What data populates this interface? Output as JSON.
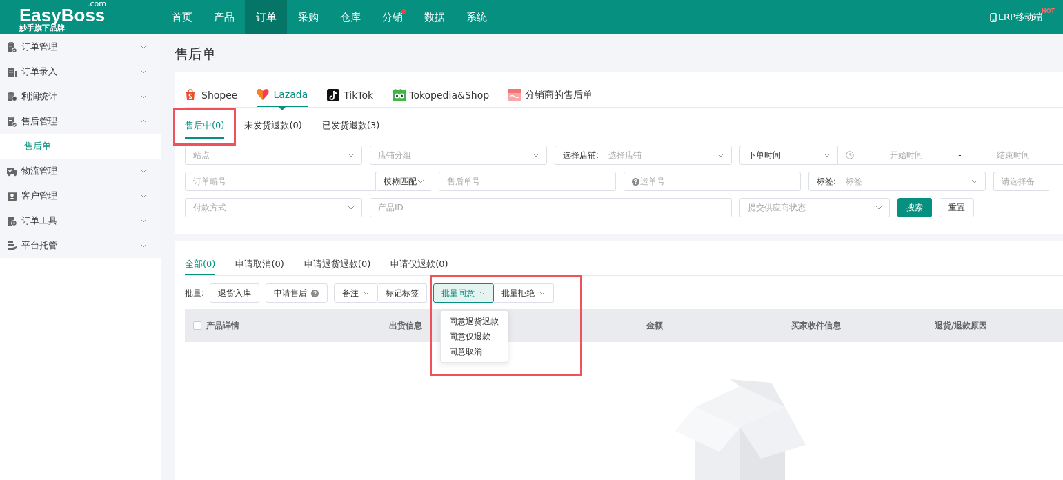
{
  "header": {
    "logo": "EasyBoss",
    "logo_suffix": ".com",
    "tagline": "妙手旗下品牌",
    "nav": [
      {
        "label": "首页",
        "selected": false,
        "badge": false
      },
      {
        "label": "产品",
        "selected": false,
        "badge": false
      },
      {
        "label": "订单",
        "selected": true,
        "badge": false
      },
      {
        "label": "采购",
        "selected": false,
        "badge": false
      },
      {
        "label": "仓库",
        "selected": false,
        "badge": false
      },
      {
        "label": "分销",
        "selected": false,
        "badge": true
      },
      {
        "label": "数据",
        "selected": false,
        "badge": false
      },
      {
        "label": "系统",
        "selected": false,
        "badge": false
      }
    ],
    "mobile_link": "ERP移动端",
    "hot_badge": "HOT"
  },
  "sidebar": {
    "items": [
      {
        "label": "订单管理",
        "kind": "clipboard",
        "expanded": false
      },
      {
        "label": "订单录入",
        "kind": "form",
        "expanded": false
      },
      {
        "label": "利润统计",
        "kind": "coins",
        "expanded": false
      },
      {
        "label": "售后管理",
        "kind": "clipboard",
        "expanded": true,
        "children": [
          {
            "label": "售后单",
            "selected": true
          }
        ]
      },
      {
        "label": "物流管理",
        "kind": "truck",
        "expanded": false
      },
      {
        "label": "客户管理",
        "kind": "person",
        "expanded": false
      },
      {
        "label": "订单工具",
        "kind": "gear",
        "expanded": false
      },
      {
        "label": "平台托管",
        "kind": "hand",
        "expanded": false
      }
    ]
  },
  "page_title": "售后单",
  "platform_tabs": [
    {
      "label": "Shopee",
      "kind": "shopee",
      "selected": false
    },
    {
      "label": "Lazada",
      "kind": "lazada",
      "selected": true
    },
    {
      "label": "TikTok",
      "kind": "tiktok",
      "selected": false
    },
    {
      "label": "Tokopedia&Shop",
      "kind": "tokopedia",
      "selected": false
    },
    {
      "label": "分销商的售后单",
      "kind": "distributor",
      "selected": false
    }
  ],
  "status_tabs": [
    {
      "label": "售后中(0)",
      "selected": true
    },
    {
      "label": "未发货退款(0)",
      "selected": false
    },
    {
      "label": "已发货退款(3)",
      "selected": false
    }
  ],
  "filter_rows": [
    {
      "fields": [
        {
          "kind": "select",
          "placeholder": "站点"
        },
        {
          "kind": "select",
          "placeholder": "店铺分组"
        },
        {
          "kind": "labeled-select",
          "label": "选择店铺:",
          "placeholder": "选择店铺"
        },
        {
          "kind": "daterange",
          "value": "下单时间",
          "start_placeholder": "开始时间",
          "separator": "-",
          "end_placeholder": "结束时间"
        }
      ]
    },
    {
      "fields": [
        {
          "kind": "combo",
          "placeholder": "订单编号",
          "value": "模糊匹配"
        },
        {
          "kind": "input",
          "placeholder": "售后单号"
        },
        {
          "kind": "help-input",
          "placeholder": "运单号"
        },
        {
          "kind": "labeled-select",
          "label": "标签:",
          "placeholder": "标签"
        },
        {
          "kind": "input",
          "placeholder": "请选择备"
        }
      ]
    },
    {
      "fields": [
        {
          "kind": "select",
          "placeholder": "付款方式"
        },
        {
          "kind": "input",
          "placeholder": "产品ID"
        },
        {
          "kind": "select",
          "placeholder": "提交供应商状态"
        },
        {
          "kind": "primary-button",
          "label": "搜索"
        },
        {
          "kind": "button",
          "label": "重置"
        }
      ]
    }
  ],
  "sub_tabs": [
    {
      "label": "全部(0)",
      "selected": true
    },
    {
      "label": "申请取消(0)",
      "selected": false
    },
    {
      "label": "申请退货退款(0)",
      "selected": false
    },
    {
      "label": "申请仅退款(0)",
      "selected": false
    }
  ],
  "batch": {
    "label": "批量:",
    "buttons": [
      {
        "label": "退货入库",
        "kind": "plain",
        "joined": false,
        "active": false
      },
      {
        "label": "申请售后",
        "kind": "help",
        "joined": false,
        "active": false
      },
      {
        "label": "备注",
        "kind": "dropdown",
        "joined": false,
        "active": false
      },
      {
        "label": "标记标签",
        "kind": "plain",
        "joined": true,
        "active": false
      },
      {
        "label": "批量同意",
        "kind": "dropdown",
        "joined": false,
        "active": true
      },
      {
        "label": "批量拒绝",
        "kind": "dropdown",
        "joined": true,
        "active": false
      }
    ]
  },
  "dropdown_menu": [
    "同意退货退款",
    "同意仅退款",
    "同意取消"
  ],
  "table": {
    "select_all": {
      "checked": false
    },
    "columns": [
      "产品详情",
      "出货信息",
      "金额",
      "买家收件信息",
      "退货/退款原因"
    ]
  }
}
